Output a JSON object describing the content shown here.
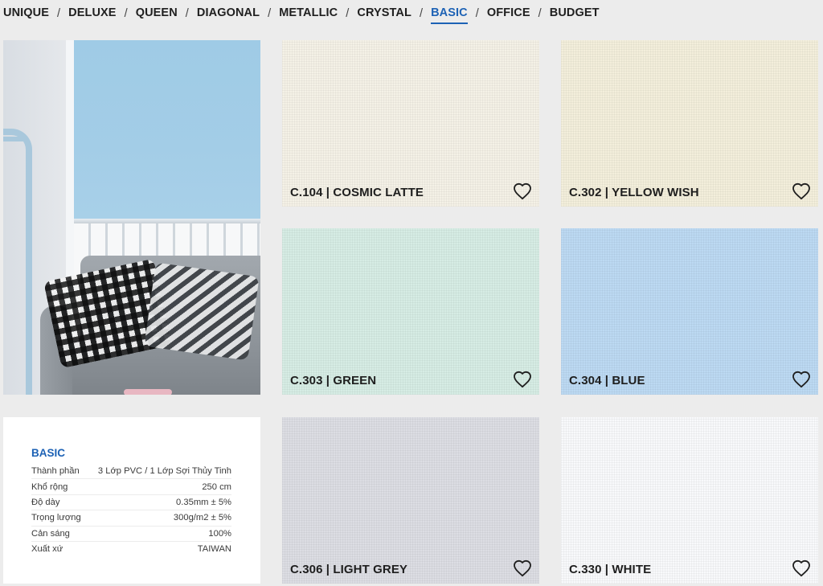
{
  "nav": {
    "items": [
      {
        "label": "UNIQUE",
        "active": false
      },
      {
        "label": "DELUXE",
        "active": false
      },
      {
        "label": "QUEEN",
        "active": false
      },
      {
        "label": "DIAGONAL",
        "active": false
      },
      {
        "label": "METALLIC",
        "active": false
      },
      {
        "label": "CRYSTAL",
        "active": false
      },
      {
        "label": "BASIC",
        "active": true
      },
      {
        "label": "OFFICE",
        "active": false
      },
      {
        "label": "BUDGET",
        "active": false
      }
    ],
    "separator": "/",
    "active_color": "#1d62b5"
  },
  "spec": {
    "title": "BASIC",
    "rows": [
      {
        "key": "Thành phần",
        "value": "3 Lớp PVC / 1 Lớp Sợi Thủy Tinh"
      },
      {
        "key": "Khổ rộng",
        "value": "250 cm"
      },
      {
        "key": "Độ dày",
        "value": "0.35mm ± 5%"
      },
      {
        "key": "Trọng lượng",
        "value": "300g/m2 ± 5%"
      },
      {
        "key": "Cản sáng",
        "value": "100%"
      },
      {
        "key": "Xuất xứ",
        "value": "TAIWAN"
      }
    ]
  },
  "swatches": [
    {
      "label": "C.104 | COSMIC LATTE",
      "color": "#f4f1e6",
      "icon": "heart-outline-icon"
    },
    {
      "label": "C.302 | YELLOW WISH",
      "color": "#f3eedb",
      "icon": "heart-outline-icon"
    },
    {
      "label": "C.303 | GREEN",
      "color": "#d6ece4",
      "icon": "heart-outline-icon"
    },
    {
      "label": "C.304 | BLUE",
      "color": "#bcd9f2",
      "icon": "heart-outline-icon"
    },
    {
      "label": "C.306 | LIGHT GREY",
      "color": "#dcdde3",
      "icon": "heart-outline-icon"
    },
    {
      "label": "C.330 | WHITE",
      "color": "#f8f9fb",
      "icon": "heart-outline-icon"
    }
  ]
}
